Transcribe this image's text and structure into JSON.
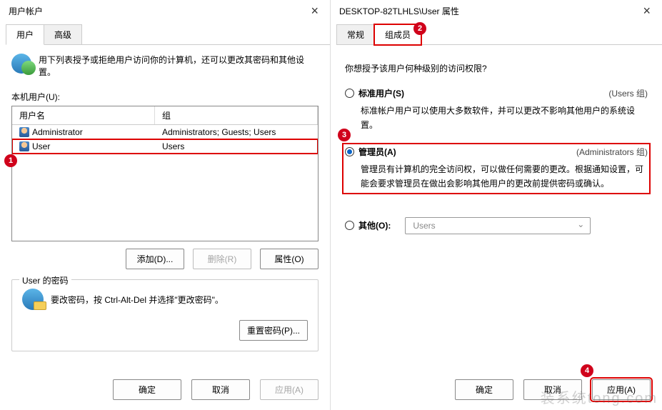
{
  "left": {
    "title": "用户帐户",
    "tabs": {
      "user": "用户",
      "advanced": "高级"
    },
    "intro": "用下列表授予或拒绝用户访问你的计算机，还可以更改其密码和其他设置。",
    "local_users_label": "本机用户(U):",
    "columns": {
      "name": "用户名",
      "group": "组"
    },
    "rows": [
      {
        "name": "Administrator",
        "group": "Administrators; Guests; Users"
      },
      {
        "name": "User",
        "group": "Users"
      }
    ],
    "buttons": {
      "add": "添加(D)...",
      "remove": "删除(R)",
      "properties": "属性(O)"
    },
    "pwbox": {
      "title": "User 的密码",
      "text": "要改密码，按 Ctrl-Alt-Del 并选择\"更改密码\"。",
      "reset": "重置密码(P)..."
    },
    "dlg": {
      "ok": "确定",
      "cancel": "取消",
      "apply": "应用(A)"
    }
  },
  "right": {
    "title": "DESKTOP-82TLHLS\\User 属性",
    "tabs": {
      "general": "常规",
      "member": "组成员"
    },
    "question": "你想授予该用户何种级别的访问权限?",
    "opt_standard": {
      "label": "标准用户(S)",
      "note": "(Users 组)",
      "desc": "标准帐户用户可以使用大多数软件，并可以更改不影响其他用户的系统设置。"
    },
    "opt_admin": {
      "label": "管理员(A)",
      "note": "(Administrators 组)",
      "desc": "管理员有计算机的完全访问权，可以做任何需要的更改。根据通知设置，可能会要求管理员在做出会影响其他用户的更改前提供密码或确认。"
    },
    "opt_other": {
      "label": "其他(O):",
      "value": "Users"
    },
    "dlg": {
      "ok": "确定",
      "cancel": "取消",
      "apply": "应用(A)"
    }
  },
  "badges": {
    "b1": "1",
    "b2": "2",
    "b3": "3",
    "b4": "4"
  },
  "watermark": "装系统tong.com"
}
